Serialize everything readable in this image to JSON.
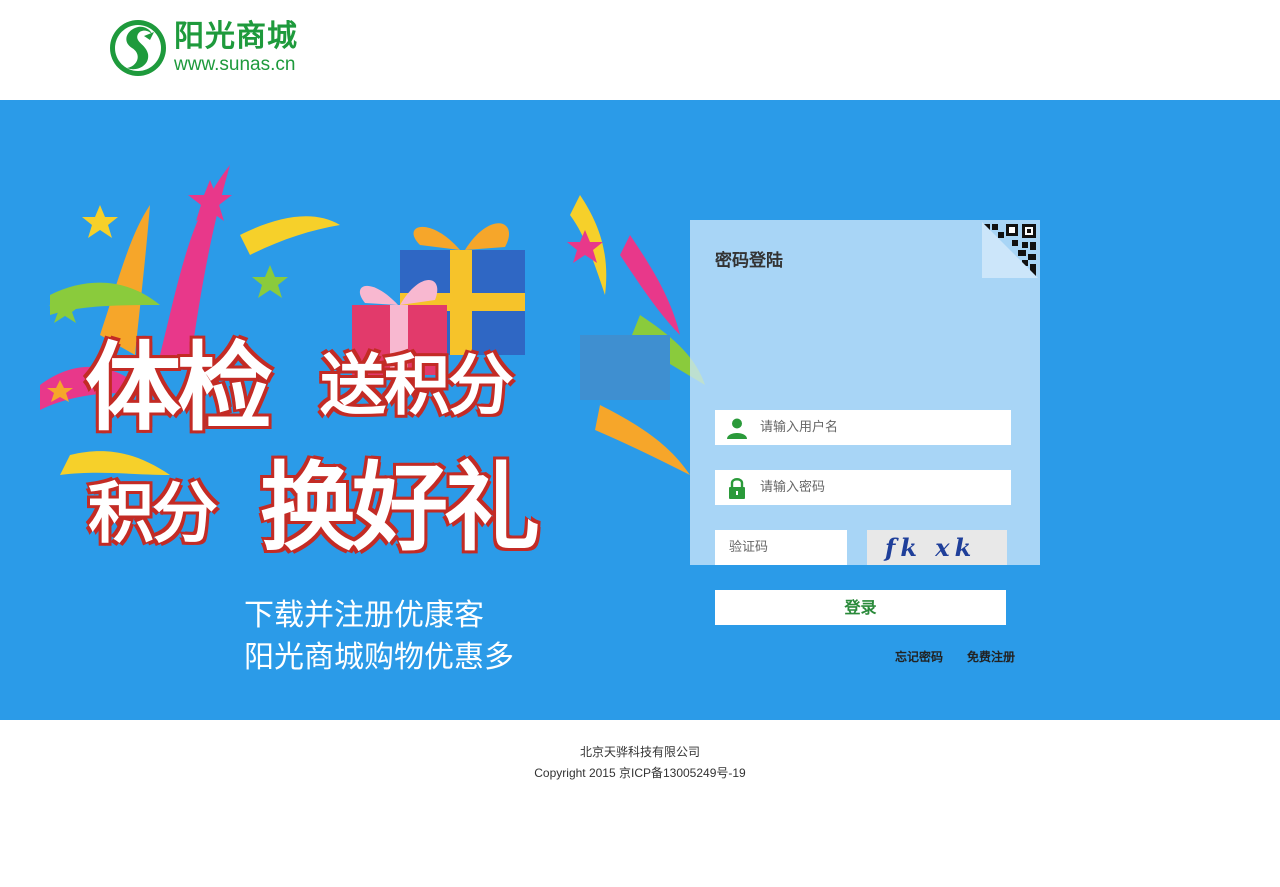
{
  "brand": {
    "name_cn": "阳光商城",
    "url": "www.sunas.cn",
    "color": "#1e9a3c"
  },
  "banner": {
    "background": "#2b9be8",
    "headline_line1_big": "体检",
    "headline_line1_small": "送积分",
    "headline_line2_small": "积分",
    "headline_line2_big": "换好礼",
    "sub_line1": "下载并注册优康客",
    "sub_line2": "阳光商城购物优惠多"
  },
  "login": {
    "title": "密码登陆",
    "username_placeholder": "请输入用户名",
    "password_placeholder": "请输入密码",
    "captcha_placeholder": "验证码",
    "captcha_text": "fk xk",
    "submit_label": "登录",
    "forgot_label": "忘记密码",
    "register_label": "免费注册",
    "qr_icon": "qr-code-icon"
  },
  "footer": {
    "company": "北京天骅科技有限公司",
    "copyright": "Copyright 2015 京ICP备13005249号-19"
  }
}
